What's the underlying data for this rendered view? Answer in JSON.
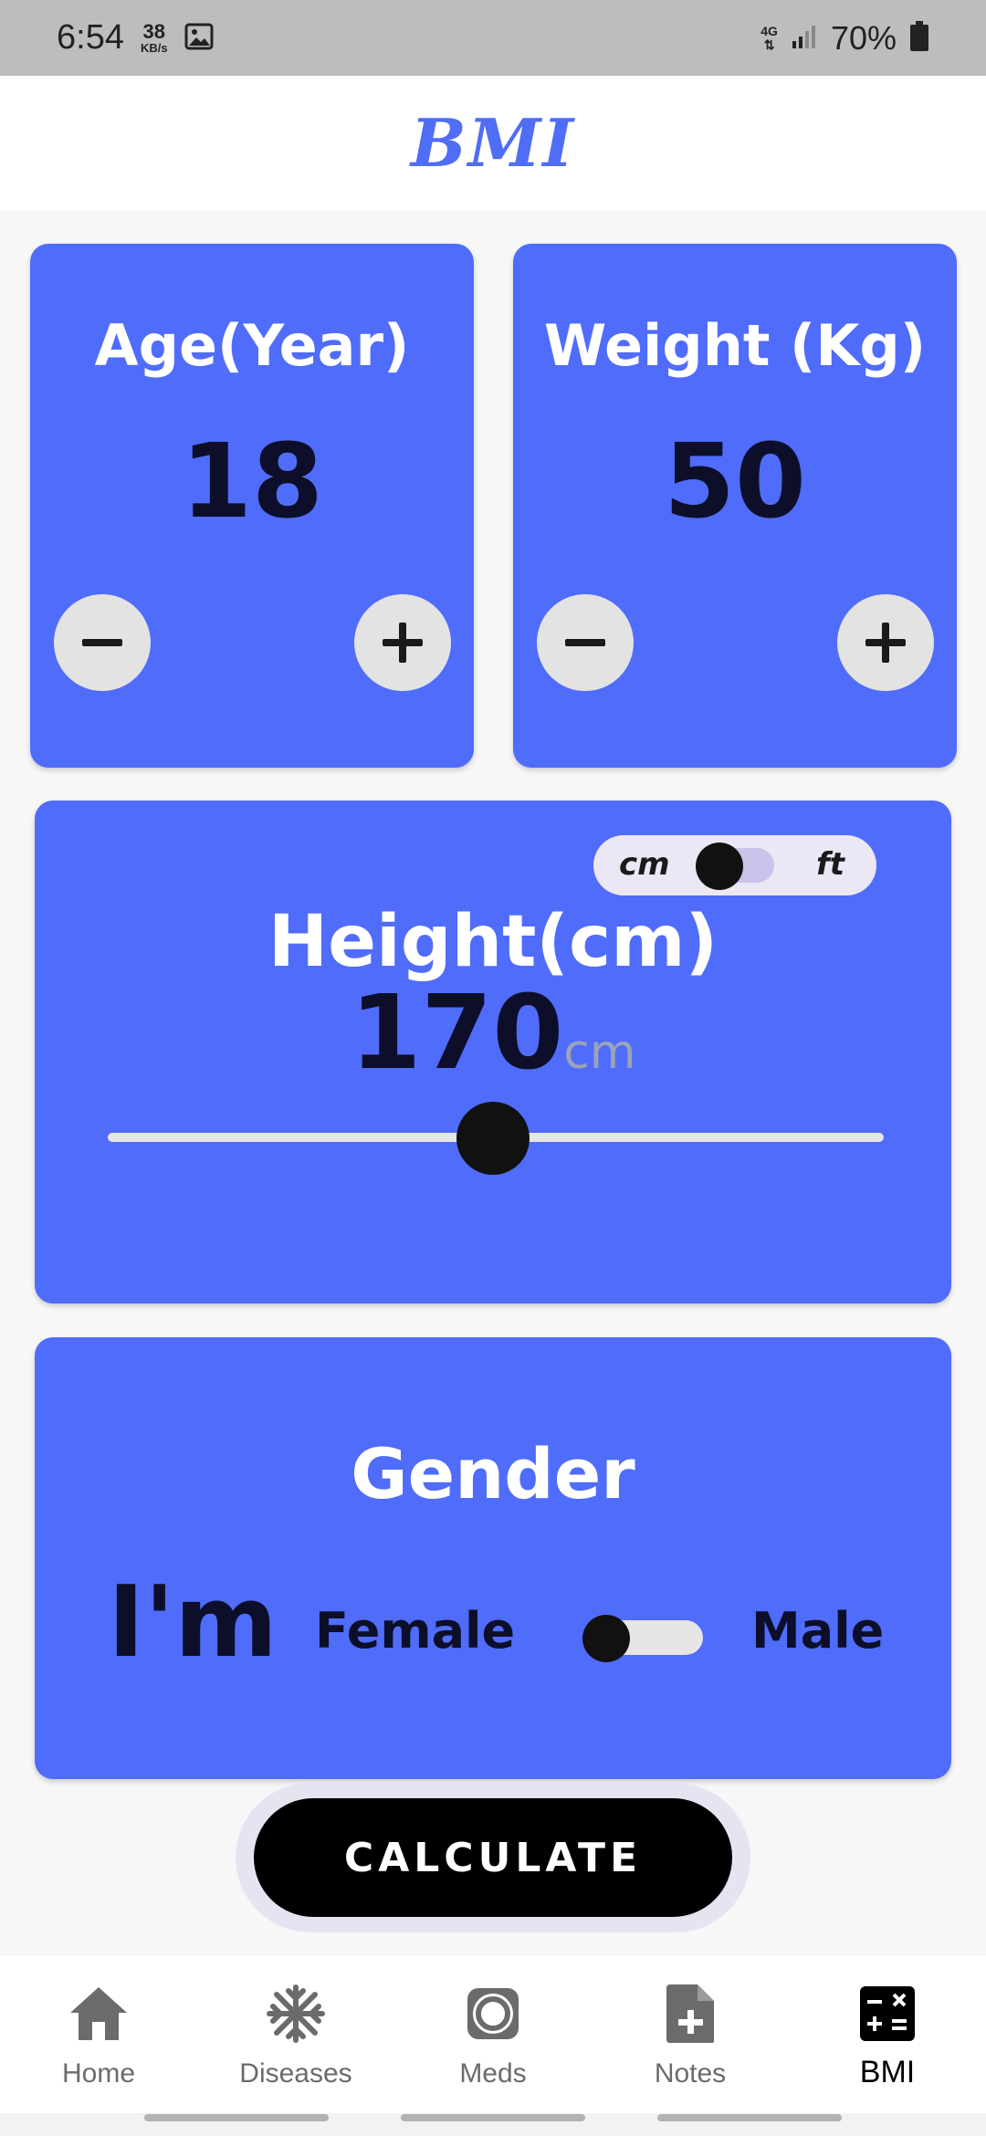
{
  "status_bar": {
    "time": "6:54",
    "speed_value": "38",
    "speed_unit": "KB/s",
    "network": "4G",
    "battery": "70%"
  },
  "header": {
    "title": "BMI"
  },
  "age_card": {
    "title": "Age(Year)",
    "value": "18"
  },
  "weight_card": {
    "title": "Weight (Kg)",
    "value": "50"
  },
  "height_card": {
    "title": "Height(cm)",
    "value": "170",
    "unit": "cm",
    "toggle_left": "cm",
    "toggle_right": "ft",
    "slider_fraction": 0.5
  },
  "gender_card": {
    "title": "Gender",
    "prefix": "I'm",
    "female_label": "Female",
    "male_label": "Male"
  },
  "calculate_label": "CALCULATE",
  "bottom_nav": [
    {
      "label": "Home",
      "icon": "home-icon"
    },
    {
      "label": "Diseases",
      "icon": "snowflake-icon"
    },
    {
      "label": "Meds",
      "icon": "ring-icon"
    },
    {
      "label": "Notes",
      "icon": "note-add-icon"
    },
    {
      "label": "BMI",
      "icon": "calculator-icon"
    }
  ],
  "colors": {
    "card": "#506cfb",
    "title_accent": "#4f6df5",
    "button": "#000000"
  }
}
